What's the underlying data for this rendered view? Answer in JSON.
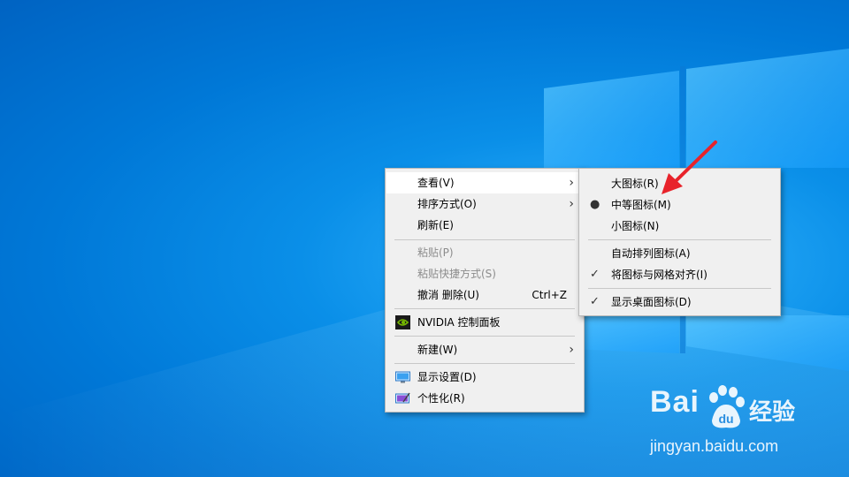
{
  "main_menu": {
    "items": [
      {
        "label": "查看(V)"
      },
      {
        "label": "排序方式(O)"
      },
      {
        "label": "刷新(E)"
      },
      {
        "label": "粘贴(P)"
      },
      {
        "label": "粘贴快捷方式(S)"
      },
      {
        "label": "撤消 删除(U)",
        "shortcut": "Ctrl+Z"
      },
      {
        "label": "NVIDIA 控制面板"
      },
      {
        "label": "新建(W)"
      },
      {
        "label": "显示设置(D)"
      },
      {
        "label": "个性化(R)"
      }
    ]
  },
  "view_submenu": {
    "items": [
      {
        "label": "大图标(R)"
      },
      {
        "label": "中等图标(M)"
      },
      {
        "label": "小图标(N)"
      },
      {
        "label": "自动排列图标(A)"
      },
      {
        "label": "将图标与网格对齐(I)"
      },
      {
        "label": "显示桌面图标(D)"
      }
    ]
  },
  "watermark": {
    "brand": "Bai",
    "brand_suffix": "经验",
    "url": "jingyan.baidu.com"
  },
  "colors": {
    "desktop_accent": "#0078d7",
    "menu_bg": "#f0f0f0",
    "arrow": "#e8232b"
  }
}
